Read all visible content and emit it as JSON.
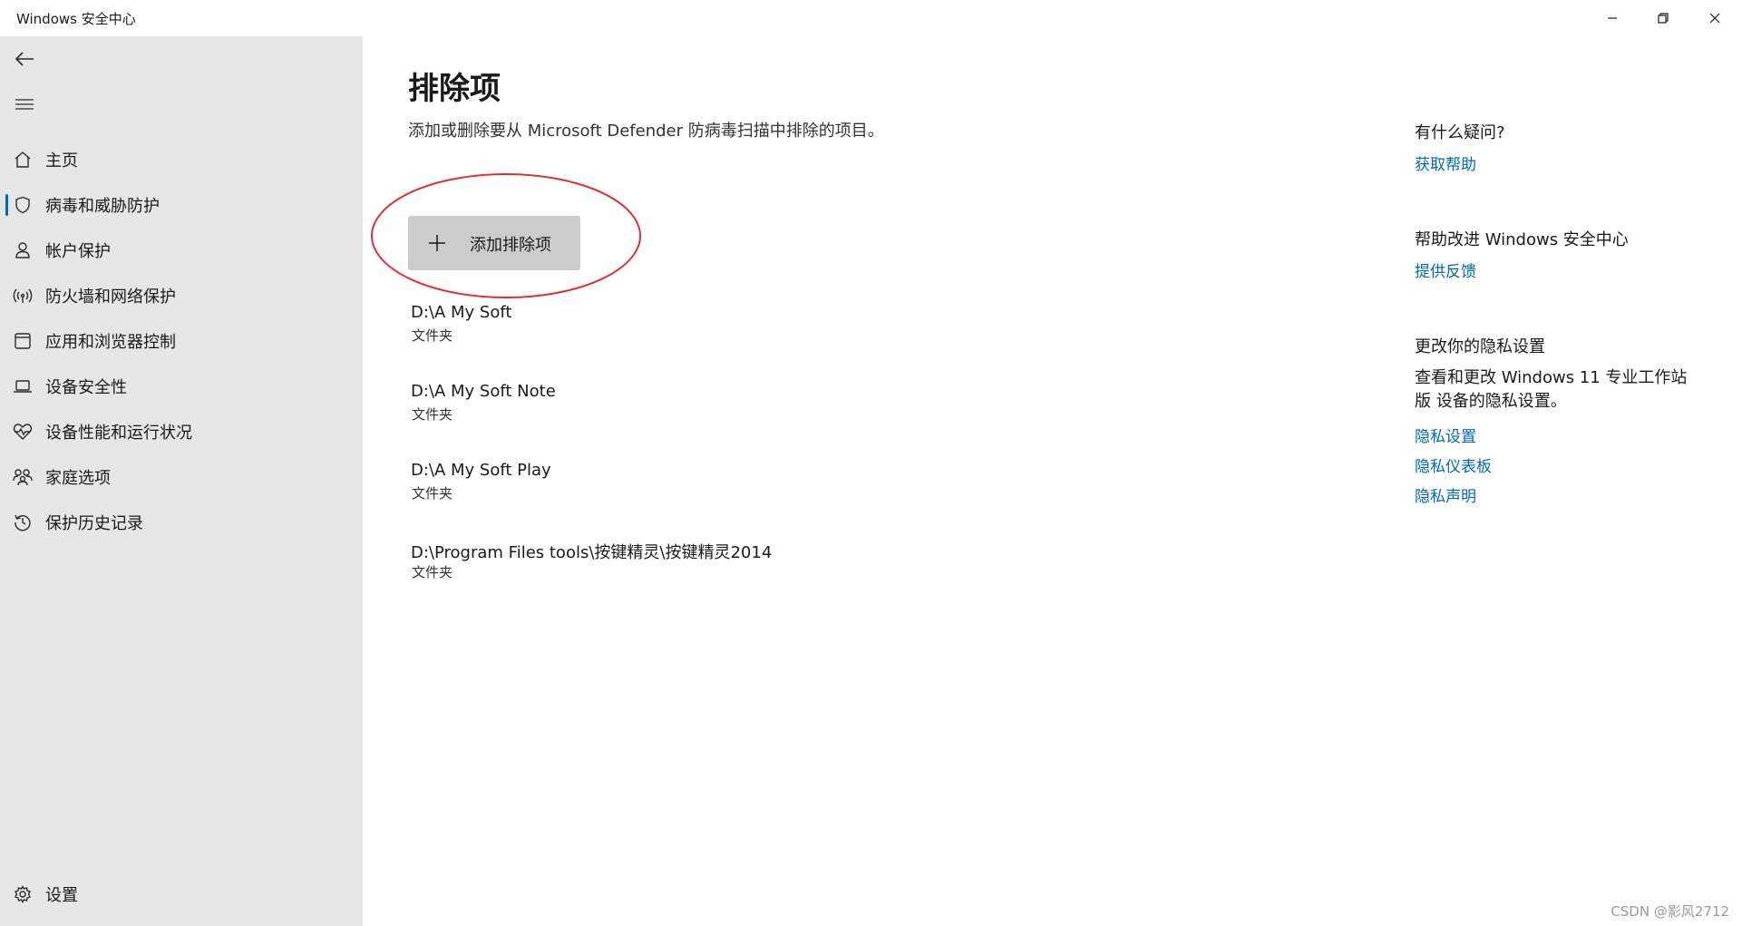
{
  "window": {
    "title": "Windows 安全中心"
  },
  "sidebar": {
    "items": [
      {
        "label": "主页",
        "icon": "home-icon"
      },
      {
        "label": "病毒和威胁防护",
        "icon": "shield-icon",
        "active": true
      },
      {
        "label": "帐户保护",
        "icon": "person-icon"
      },
      {
        "label": "防火墙和网络保护",
        "icon": "wireless-icon"
      },
      {
        "label": "应用和浏览器控制",
        "icon": "browser-window-icon"
      },
      {
        "label": "设备安全性",
        "icon": "laptop-icon"
      },
      {
        "label": "设备性能和运行状况",
        "icon": "heart-pulse-icon"
      },
      {
        "label": "家庭选项",
        "icon": "family-icon"
      },
      {
        "label": "保护历史记录",
        "icon": "history-icon"
      }
    ],
    "settings_label": "设置"
  },
  "main": {
    "title": "排除项",
    "description": "添加或删除要从 Microsoft Defender 防病毒扫描中排除的项目。",
    "add_button_label": "添加排除项",
    "exclusions": [
      {
        "path": "D:\\A My Soft",
        "type": "文件夹"
      },
      {
        "path": "D:\\A My Soft Note",
        "type": "文件夹"
      },
      {
        "path": "D:\\A My Soft Play",
        "type": "文件夹"
      },
      {
        "path": "D:\\Program Files tools\\按键精灵\\按键精灵2014",
        "type": "文件夹"
      }
    ]
  },
  "right_panel": {
    "questions_heading": "有什么疑问?",
    "get_help_link": "获取帮助",
    "improve_heading": "帮助改进 Windows 安全中心",
    "feedback_link": "提供反馈",
    "privacy_heading": "更改你的隐私设置",
    "privacy_text": "查看和更改 Windows 11 专业工作站版 设备的隐私设置。",
    "privacy_settings_link": "隐私设置",
    "privacy_dashboard_link": "隐私仪表板",
    "privacy_statement_link": "隐私声明"
  },
  "watermark": "CSDN @影风2712",
  "colors": {
    "accent": "#0067c0",
    "sidebar_bg": "#e6e6e6",
    "button_bg": "#cccccc",
    "annotation": "#e03030"
  }
}
